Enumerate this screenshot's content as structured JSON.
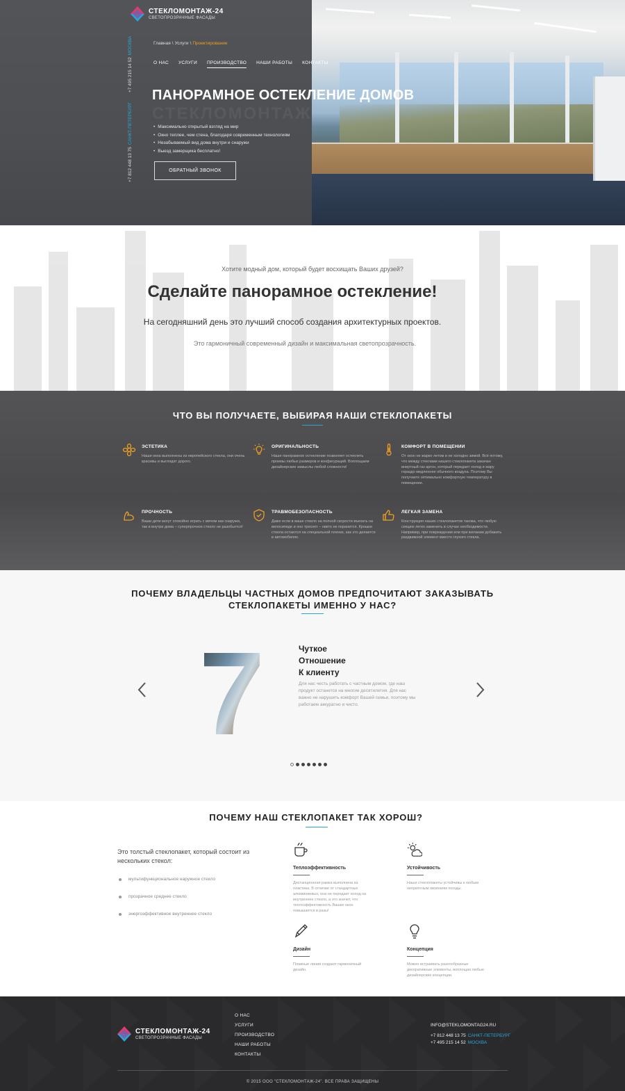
{
  "brand": {
    "name": "СТЕКЛОМОНТАЖ-24",
    "tagline": "СВЕТОПРОЗРАЧНЫЕ ФАСАДЫ",
    "colors": {
      "accent_blue": "#29a7d8",
      "accent_orange": "#f0a020",
      "pink": "#e8396b",
      "dark": "#2a2a2c"
    }
  },
  "hero": {
    "phones": [
      {
        "number": "+7 495 215 14 52",
        "city": "МОСКВА"
      },
      {
        "number": "+7 812 448 13 75",
        "city": "САНКТ-ПЕТЕРБУРГ"
      }
    ],
    "breadcrumb": {
      "home": "Главная",
      "services": "Услуги",
      "current": "Проектирование",
      "separator": "\\"
    },
    "nav": [
      "О НАС",
      "УСЛУГИ",
      "ПРОИЗВОДСТВО",
      "НАШИ РАБОТЫ",
      "КОНТАКТЫ"
    ],
    "nav_active_index": 2,
    "title": "ПАНОРАМНОЕ ОСТЕКЛЕНИЕ ДОМОВ",
    "ghost_text": "СТЕКЛОМОНТАЖ",
    "bullets": [
      "Максимально открытый взгляд на мир",
      "Окно теплее, чем стена, благодаря современным технологиям",
      "Незабываемый вид дома внутри и снаружи",
      "Выезд замерщика бесплатно!"
    ],
    "cta_label": "ОБРАТНЫЙ ЗВОНОК"
  },
  "intro": {
    "question": "Хотите модный дом, который будет восхищать Ваших друзей?",
    "title": "Сделайте панорамное остекление!",
    "subtitle": "На сегодняшний день это лучший способ создания архитектурных проектов.",
    "text": "Это гармоничный современный дизайн и максимальная светопрозрачность."
  },
  "features": {
    "title": "ЧТО ВЫ ПОЛУЧАЕТЕ, ВЫБИРАЯ НАШИ СТЕКЛОПАКЕТЫ",
    "items": [
      {
        "icon": "flower-icon",
        "title": "ЭСТЕТИКА",
        "text": "Наши окна выполнены из европейского стекла, они очень красивы и выглядят дорого."
      },
      {
        "icon": "bulb-icon",
        "title": "ОРИГИНАЛЬНОСТЬ",
        "text": "Наше панорамное остекление позволяет остеклить проемы любых размеров и конфигураций. Воплощаем дизайнерские замыслы любой сложности!"
      },
      {
        "icon": "thermometer-icon",
        "title": "КОМФОРТ В ПОМЕЩЕНИИ",
        "text": "От окон не жарко летом и не холодно зимой. Всё потому, что между стеклами нашего стеклопакета закачан инертный газ аргон, который передает холод и жару гораздо медленнее обычного воздуха. Поэтому Вы получаете оптимально комфортную температуру в помещении."
      },
      {
        "icon": "muscle-icon",
        "title": "ПРОЧНОСТЬ",
        "text": "Ваши дети могут спокойно играть с мячом как снаружи, так и внутри дома – суперпрочное стекло не разобьется!"
      },
      {
        "icon": "shield-icon",
        "title": "ТРАВМОБЕЗОПАСНОСТЬ",
        "text": "Даже если в ваше стекло на полной скорости въехать на велосипеде и оно треснет – никто не поранится. Крошки стекла остаются на специальной пленке, как это делается в автомобилях."
      },
      {
        "icon": "thumb-up-icon",
        "title": "ЛЕГКАЯ ЗАМЕНА",
        "text": "Конструкция наших стеклопакетов такова, что любую секцию легко заменить в случае необходимости. Например, при повреждении или при желании добавить раздвижной элемент вместо глухого стекла."
      }
    ]
  },
  "why": {
    "title_line1": "ПОЧЕМУ ВЛАДЕЛЬЦЫ ЧАСТНЫХ ДОМОВ ПРЕДПОЧИТАЮТ ЗАКАЗЫВАТЬ",
    "title_line2": "СТЕКЛОПАКЕТЫ ИМЕННО У НАС?",
    "slide": {
      "number": "7",
      "title_lines": [
        "Чуткое",
        "Отношение",
        "К клиенту"
      ],
      "text": "Для нас честь работать с частным домом, где наш продукт останется на многие десятилетия. Для нас важно не нарушить комфорт Вашей семьи, поэтому мы работаем аккуратно и чисто."
    },
    "dots_total": 7,
    "dots_active": 0,
    "prev_icon": "chevron-left-icon",
    "next_icon": "chevron-right-icon"
  },
  "quality": {
    "title": "ПОЧЕМУ НАШ СТЕКЛОПАКЕТ ТАК ХОРОШ?",
    "intro": "Это толстый стеклопакет, который состоит из нескольких стекол:",
    "layers": [
      "мультифункциональное наружное стекло",
      "прозрачное среднее стекло",
      "энергоэффективное внутреннее стекло"
    ],
    "benefits": [
      {
        "icon": "cup-icon",
        "title": "Теплоэффективность",
        "text": "Дистанционная рамка выполнена из пластика. В отличие от стандартных алюминиевых, она не передает холод на внутреннее стекло, а это значит, что теплоэффективность Ваших окон повышается в разы!"
      },
      {
        "icon": "weather-icon",
        "title": "Устойчивость",
        "text": "Наши стеклопакеты устойчивы к любым неприятным явлениям погоды."
      },
      {
        "icon": "pencil-icon",
        "title": "Дизайн",
        "text": "Плавные линии создают гармоничный дизайн."
      },
      {
        "icon": "lightbulb-icon",
        "title": "Концепция",
        "text": "Можно встраивать разнообразные декоративные элементы, воплощая любые дизайнерские концепции."
      }
    ]
  },
  "footer": {
    "nav": [
      "О НАС",
      "УСЛУГИ",
      "ПРОИЗВОДСТВО",
      "НАШИ РАБОТЫ",
      "КОНТАКТЫ"
    ],
    "email": "INFO@STEKLOMONTAG24.RU",
    "phones": [
      {
        "number": "+7 812 448 13 75",
        "city": "САНКТ-ПЕТЕРБУРГ"
      },
      {
        "number": "+7 495 215 14 52",
        "city": "МОСКВА"
      }
    ],
    "copyright": "© 2015 ООО \"СТЕКЛОМОНТАЖ-24\". ВСЕ ПРАВА ЗАЩИЩЕНЫ"
  }
}
